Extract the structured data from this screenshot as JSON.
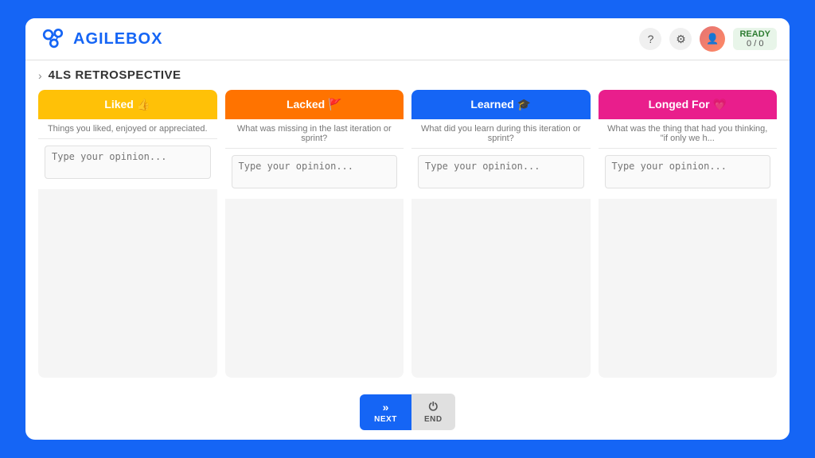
{
  "app": {
    "name": "AGILEBOX"
  },
  "header": {
    "title": "4LS RETROSPECTIVE",
    "chevron": "›",
    "ready_label": "READY",
    "ready_count": "0 / 0",
    "help_icon": "?",
    "settings_icon": "⚙"
  },
  "columns": [
    {
      "id": "liked",
      "label": "Liked 👍",
      "description": "Things you liked, enjoyed or appreciated.",
      "placeholder": "Type your opinion...",
      "color": "#FFC107",
      "emoji": "👍"
    },
    {
      "id": "lacked",
      "label": "Lacked 🚩",
      "description": "What was missing in the last iteration or sprint?",
      "placeholder": "Type your opinion...",
      "color": "#FF7300",
      "emoji": "🚩"
    },
    {
      "id": "learned",
      "label": "Learned 🎓",
      "description": "What did you learn during this iteration or sprint?",
      "placeholder": "Type your opinion...",
      "color": "#1565F5",
      "emoji": "🎓"
    },
    {
      "id": "longed",
      "label": "Longed For 💗",
      "description": "What was the thing that had you thinking, \"if only we h...",
      "placeholder": "Type your opinion...",
      "color": "#E91E8C",
      "emoji": "💗"
    }
  ],
  "buttons": {
    "next_label": "NEXT",
    "next_icon": "»",
    "end_label": "END",
    "end_icon": "⏻"
  }
}
